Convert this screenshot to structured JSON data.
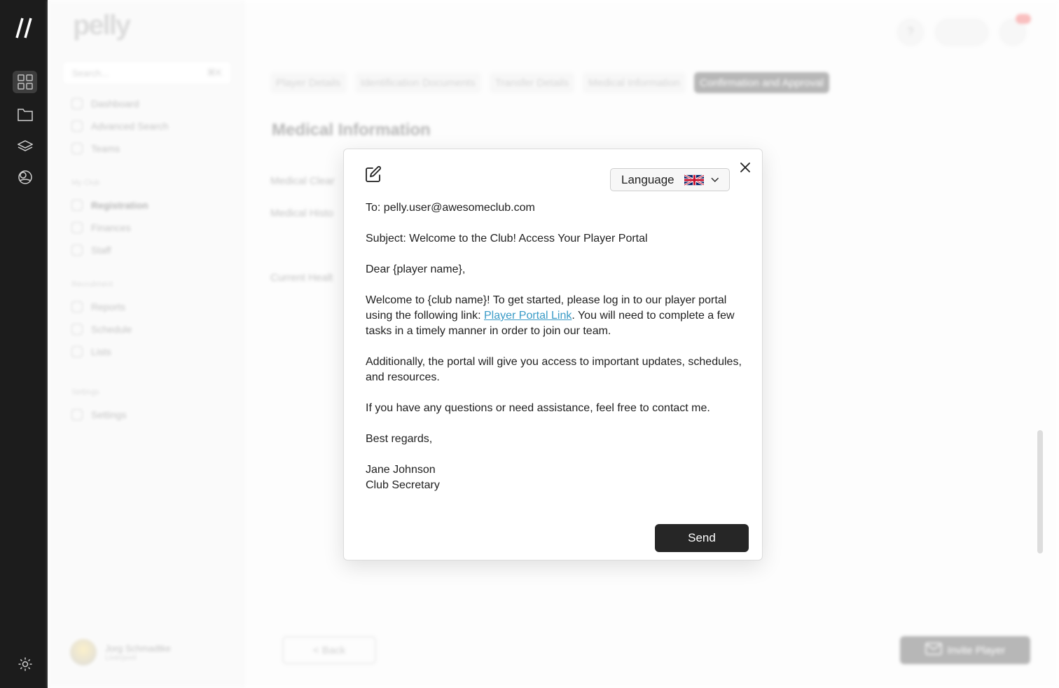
{
  "rail": {
    "items": [
      "dashboard-grid",
      "folder",
      "layers",
      "globe"
    ],
    "settings_icon": "gear-icon"
  },
  "sidebar": {
    "brand": "pelly",
    "search_placeholder": "Search...",
    "search_shortcut": "⌘K",
    "items_top": [
      "Dashboard",
      "Advanced Search",
      "Teams"
    ],
    "section_my_club": "My Club",
    "items_club": [
      "Registration",
      "Finances",
      "Staff"
    ],
    "section_recruitment": "Recruitment",
    "items_recruitment": [
      "Reports",
      "Schedule",
      "Lists"
    ],
    "section_settings": "Settings",
    "items_settings": [
      "Settings"
    ],
    "user": {
      "name": "Jorg Schmadtke",
      "location": "Liverpool"
    }
  },
  "main": {
    "steps": [
      "Player Details",
      "Identification Documents",
      "Transfer Details",
      "Medical Information",
      "Confirmation and Approval"
    ],
    "section_title": "Medical Information",
    "field_labels": [
      "Medical Clear",
      "Medical Histo",
      "Current Healt"
    ],
    "back_label": "< Back",
    "invite_label": "Invite Player",
    "help_label": "?"
  },
  "modal": {
    "language_label": "Language",
    "to_line": "To: pelly.user@awesomeclub.com",
    "subject_line": "Subject: Welcome to the Club! Access Your Player Portal",
    "greeting": "Dear {player name},",
    "para1_before": "Welcome to {club name}! To get started, please log in to our player portal using the following link: ",
    "para1_link": "Player Portal Link",
    "para1_after": ". You will need to complete a few tasks in a timely manner in order to join our team.",
    "para2": "Additionally, the portal will give you access to important updates, schedules, and resources.",
    "para3": "If you have any questions or need assistance, feel free to contact me.",
    "closing": "Best regards,",
    "sig_name": "Jane Johnson",
    "sig_title": "Club Secretary",
    "send_label": "Send"
  },
  "colors": {
    "rail_bg": "#1c1c1c",
    "link": "#3a9bc7",
    "send_bg": "#262626"
  }
}
